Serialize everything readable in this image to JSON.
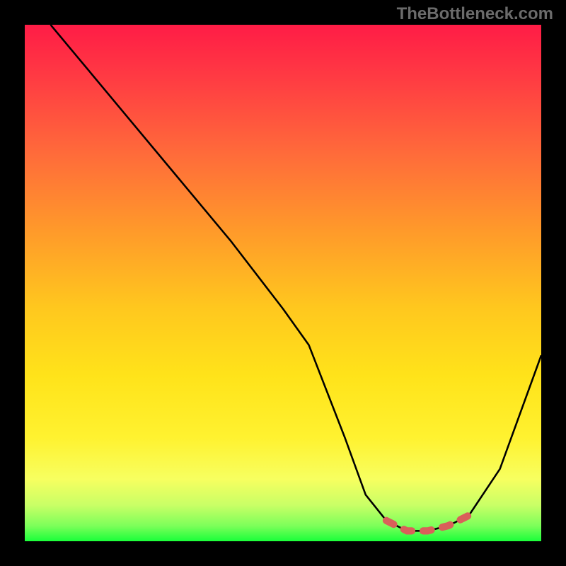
{
  "watermark": "TheBottleneck.com",
  "chart_data": {
    "type": "line",
    "title": "",
    "xlabel": "",
    "ylabel": "",
    "xlim": [
      0,
      100
    ],
    "ylim": [
      0,
      100
    ],
    "series": [
      {
        "name": "curve",
        "x": [
          5,
          10,
          20,
          30,
          40,
          50,
          55,
          62,
          66,
          70,
          74,
          78,
          82,
          86,
          92,
          100
        ],
        "y": [
          100,
          94,
          82,
          70,
          58,
          45,
          38,
          20,
          9,
          4,
          2,
          2,
          3,
          5,
          14,
          36
        ]
      }
    ],
    "marker_band_y": 5,
    "accent_marker_color": "#d9605a",
    "curve_color": "#000000"
  }
}
